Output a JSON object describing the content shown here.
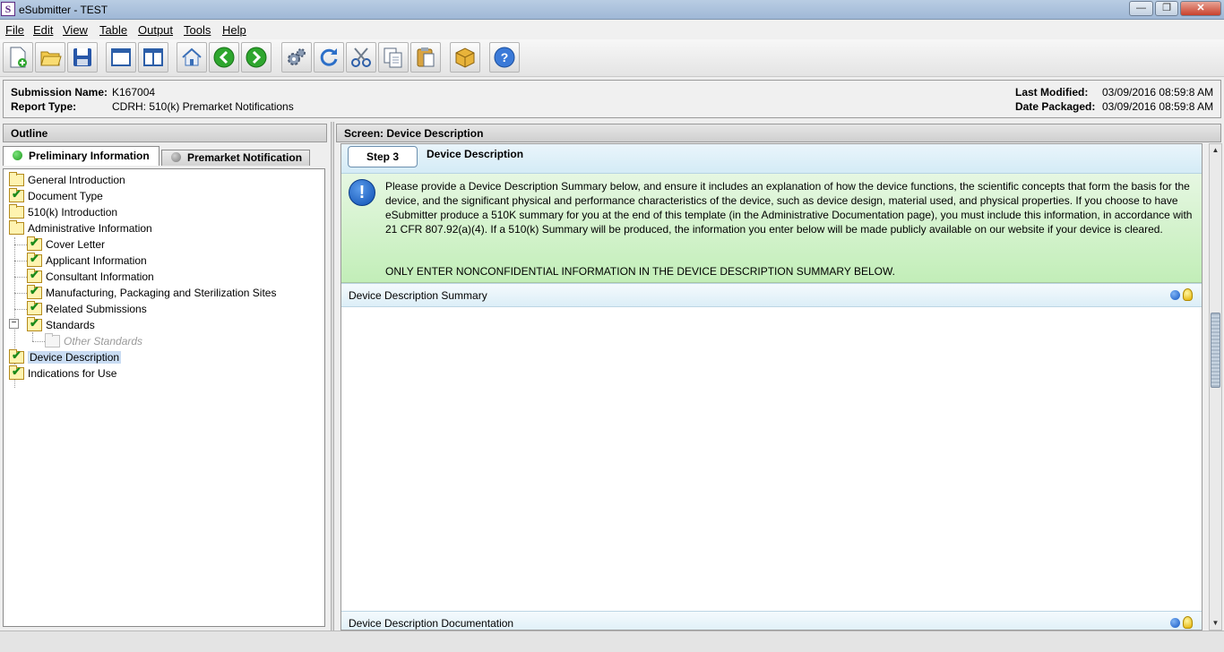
{
  "window": {
    "title": "eSubmitter - TEST",
    "app_icon_letter": "S"
  },
  "menus": [
    "File",
    "Edit",
    "View",
    "Table",
    "Output",
    "Tools",
    "Help"
  ],
  "toolbar_icons": [
    "new-document-icon",
    "open-folder-icon",
    "save-icon",
    "window-icon",
    "split-panes-icon",
    "home-icon",
    "back-arrow-icon",
    "forward-arrow-icon",
    "settings-gears-icon",
    "refresh-icon",
    "cut-scissors-icon",
    "copy-icon",
    "paste-icon",
    "package-icon",
    "help-icon"
  ],
  "submission": {
    "name_label": "Submission Name:",
    "name_value": "K167004",
    "type_label": "Report Type:",
    "type_value": "CDRH: 510(k) Premarket Notifications",
    "modified_label": "Last Modified:",
    "modified_value": "03/09/2016 08:59:8 AM",
    "packaged_label": "Date Packaged:",
    "packaged_value": "03/09/2016 08:59:8 AM"
  },
  "outline": {
    "title": "Outline",
    "tabs": [
      {
        "label": "Preliminary Information",
        "status": "green"
      },
      {
        "label": "Premarket Notification",
        "status": "grey"
      }
    ],
    "tree": [
      {
        "label": "General Introduction",
        "icon": "folder"
      },
      {
        "label": "Document Type",
        "icon": "checked-folder"
      },
      {
        "label": "510(k) Introduction",
        "icon": "folder"
      },
      {
        "label": "Administrative Information",
        "icon": "folder"
      },
      {
        "label": "Cover Letter",
        "icon": "checked-folder"
      },
      {
        "label": "Applicant Information",
        "icon": "checked-folder"
      },
      {
        "label": "Consultant Information",
        "icon": "checked-folder"
      },
      {
        "label": "Manufacturing, Packaging and Sterilization Sites",
        "icon": "checked-folder"
      },
      {
        "label": "Related Submissions",
        "icon": "checked-folder"
      },
      {
        "label": "Standards",
        "icon": "checked-folder"
      },
      {
        "label": "Other Standards",
        "icon": "disabled-folder"
      },
      {
        "label": "Device Description",
        "icon": "checked-folder",
        "selected": true
      },
      {
        "label": "Indications for Use",
        "icon": "checked-folder"
      }
    ],
    "expander_symbol": "−"
  },
  "screen": {
    "header": "Screen: Device Description",
    "step_label": "Step 3",
    "step_title": "Device Description",
    "info_icon": "!",
    "instructions": "Please provide a Device Description Summary below, and ensure it includes an explanation of how the device functions, the scientific concepts that form the basis for the device, and the significant physical and performance characteristics of the device, such as device design, material used, and physical properties. If you choose to have eSubmitter produce a 510K summary for you at the end of this template (in the Administrative Documentation page), you must include this information, in accordance with 21 CFR 807.92(a)(4).  If a 510(k) Summary will be produced,  the information you enter below will be made publicly available on our website if your device is cleared.",
    "warning": "ONLY ENTER NONCONFIDENTIAL INFORMATION IN THE DEVICE DESCRIPTION SUMMARY BELOW.",
    "summary_section": "Device Description Summary",
    "summary_text": "",
    "documentation_section": "Device Description Documentation"
  },
  "colors": {
    "accent_blue": "#1356c2",
    "note_green": "#c2eeb8",
    "selection": "#c9dcf3"
  }
}
